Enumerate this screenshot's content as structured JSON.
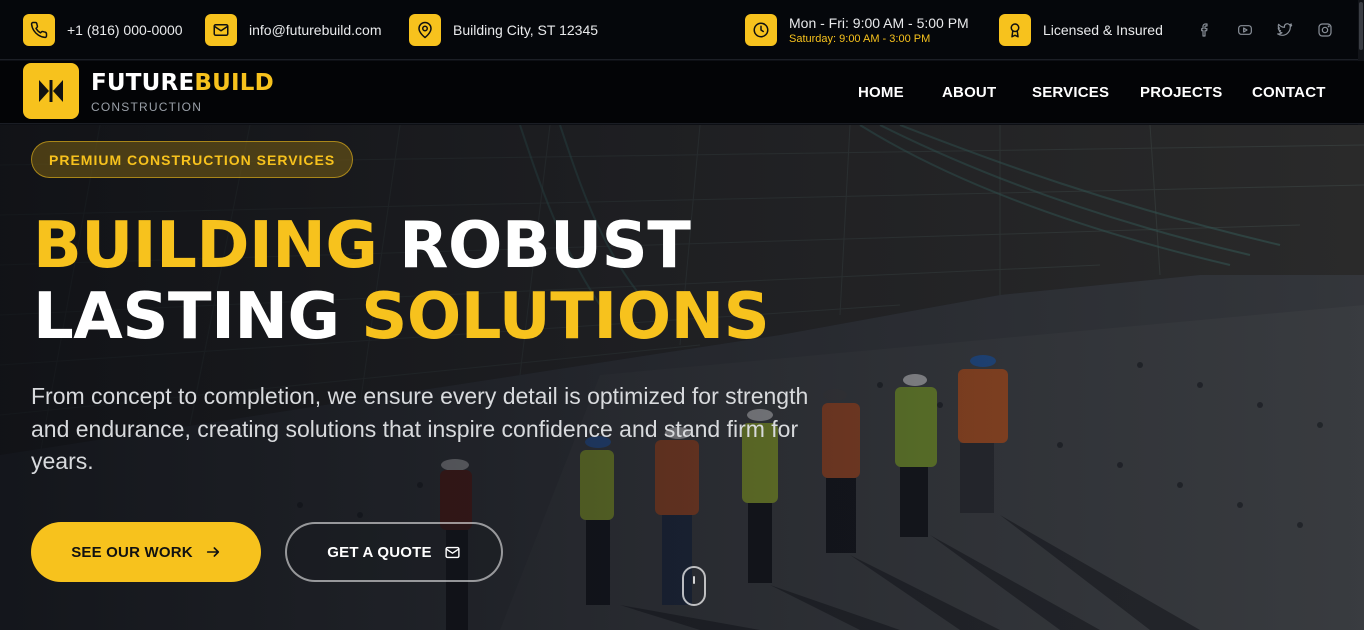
{
  "topbar": {
    "phone": "+1 (816) 000-0000",
    "email": "info@futurebuild.com",
    "location": "Building City, ST 12345",
    "hours_weekday": "Mon - Fri: 9:00 AM - 5:00 PM",
    "hours_saturday": "Saturday: 9:00 AM - 3:00 PM",
    "license": "Licensed & Insured",
    "icons": [
      "phone-icon",
      "mail-icon",
      "map-pin-icon",
      "clock-icon",
      "award-icon"
    ],
    "social": [
      "facebook-icon",
      "youtube-icon",
      "twitter-icon",
      "instagram-icon"
    ]
  },
  "brand": {
    "name_part1": "FUTURE",
    "name_part2": "BUILD",
    "tagline": "CONSTRUCTION"
  },
  "nav": {
    "items": [
      "HOME",
      "ABOUT",
      "SERVICES",
      "PROJECTS",
      "CONTACT"
    ]
  },
  "hero": {
    "badge": "PREMIUM CONSTRUCTION SERVICES",
    "headline_1a": "BUILDING",
    "headline_1b": "ROBUST",
    "headline_2a": "LASTING",
    "headline_2b": "SOLUTIONS",
    "lead": "From concept to completion, we ensure every detail is optimized for strength and endurance, creating solutions that inspire confidence and stand firm for years.",
    "primary_button": "SEE OUR WORK",
    "secondary_button": "GET A QUOTE"
  },
  "colors": {
    "accent": "#f7c21d",
    "topbar_bg": "#05070b",
    "nav_bg": "#030406"
  }
}
